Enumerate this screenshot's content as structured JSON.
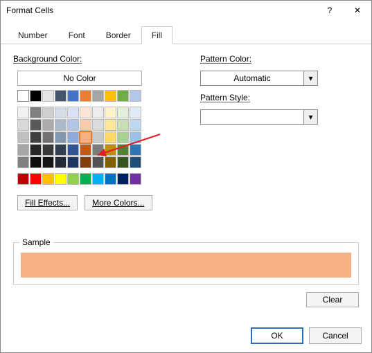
{
  "window": {
    "title": "Format Cells",
    "help": "?",
    "close": "✕"
  },
  "tabs": {
    "number": "Number",
    "font": "Font",
    "border": "Border",
    "fill": "Fill",
    "active": "fill"
  },
  "fill": {
    "bg_label": "Background Color:",
    "no_color": "No Color",
    "fill_effects": "Fill Effects...",
    "more_colors": "More Colors...",
    "theme_row": [
      "#ffffff",
      "#000000",
      "#e7e6e6",
      "#44546a",
      "#4472c4",
      "#ed7d31",
      "#a5a5a5",
      "#ffc000",
      "#70ad47",
      "#b4c7e7"
    ],
    "tints": [
      [
        "#f2f2f2",
        "#808080",
        "#d0cece",
        "#d6dce5",
        "#d9e1f2",
        "#fce4d6",
        "#ededed",
        "#fff2cc",
        "#e2efda",
        "#deeaf6"
      ],
      [
        "#d9d9d9",
        "#595959",
        "#aeaaaa",
        "#acb9ca",
        "#b4c6e7",
        "#f8cbad",
        "#dbdbdb",
        "#ffe699",
        "#c6e0b4",
        "#bdd7ee"
      ],
      [
        "#bfbfbf",
        "#404040",
        "#757171",
        "#8497b0",
        "#8ea9db",
        "#f4b084",
        "#c9c9c9",
        "#ffd966",
        "#a9d08e",
        "#9bc2e6"
      ],
      [
        "#a6a6a6",
        "#262626",
        "#3a3838",
        "#333f4f",
        "#305496",
        "#c65911",
        "#7b7b7b",
        "#bf8f00",
        "#548235",
        "#2e75b6"
      ],
      [
        "#808080",
        "#0d0d0d",
        "#161616",
        "#222b35",
        "#203764",
        "#833c0c",
        "#525252",
        "#806000",
        "#375623",
        "#1f4e78"
      ]
    ],
    "standard": [
      "#c00000",
      "#ff0000",
      "#ffc000",
      "#ffff00",
      "#92d050",
      "#00b050",
      "#00b0f0",
      "#0070c0",
      "#002060",
      "#7030a0"
    ],
    "selected": "#f4b084"
  },
  "pattern": {
    "color_label": "Pattern Color:",
    "color_value": "Automatic",
    "style_label": "Pattern Style:",
    "style_value": ""
  },
  "sample": {
    "label": "Sample",
    "color": "#f4b084"
  },
  "buttons": {
    "clear": "Clear",
    "ok": "OK",
    "cancel": "Cancel"
  }
}
